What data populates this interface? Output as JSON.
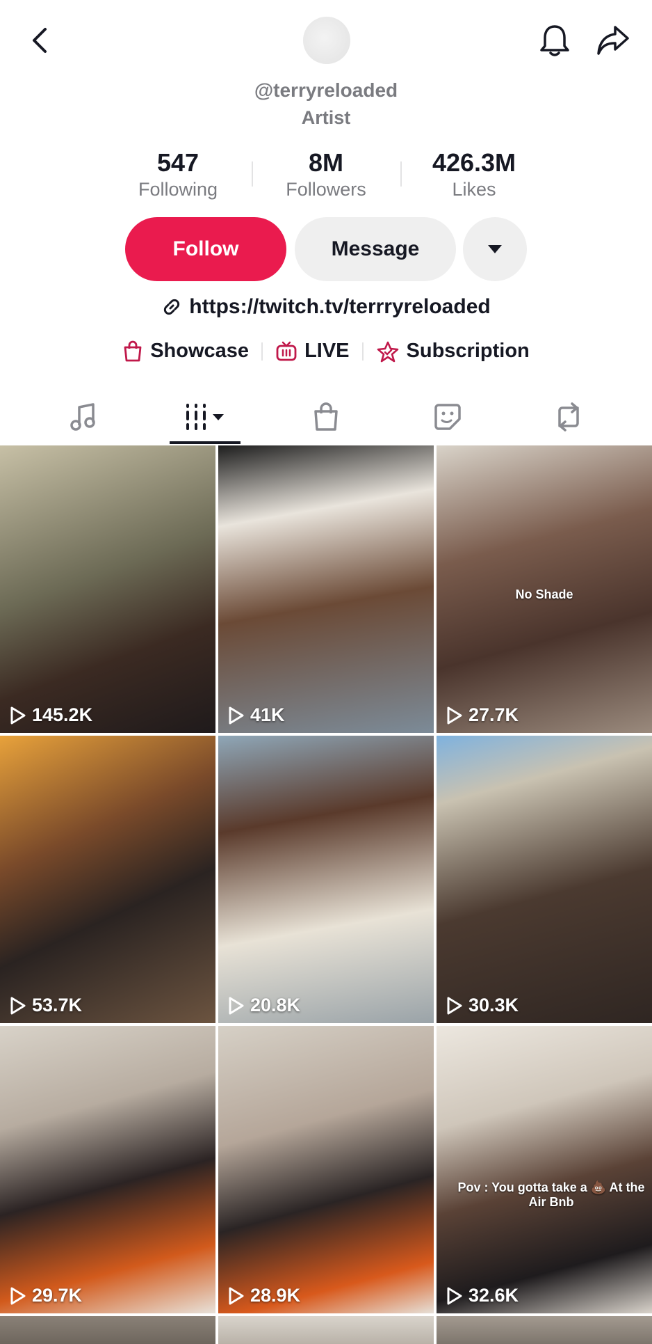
{
  "header": {
    "back_icon": "chevron-left-icon",
    "bell_icon": "bell-icon",
    "share_icon": "share-arrow-icon"
  },
  "profile": {
    "handle": "@terryreloaded",
    "bio": "Artist"
  },
  "stats": [
    {
      "value": "547",
      "label": "Following"
    },
    {
      "value": "8M",
      "label": "Followers"
    },
    {
      "value": "426.3M",
      "label": "Likes"
    }
  ],
  "actions": {
    "follow_label": "Follow",
    "message_label": "Message",
    "more_icon": "triangle-down-icon",
    "accent_color": "#ea1b4e"
  },
  "link": {
    "icon": "link-icon",
    "text": "https://twitch.tv/terrryreloaded"
  },
  "features": [
    {
      "icon": "shopping-bag-icon",
      "label": "Showcase"
    },
    {
      "icon": "live-tv-icon",
      "label": "LIVE"
    },
    {
      "icon": "star-badge-icon",
      "label": "Subscription"
    }
  ],
  "tabs": [
    {
      "icon": "music-note-icon",
      "active": false
    },
    {
      "icon": "videos-grid-icon",
      "active": true
    },
    {
      "icon": "shopping-bag-icon",
      "active": false
    },
    {
      "icon": "sticker-icon",
      "active": false
    },
    {
      "icon": "repost-icon",
      "active": false
    }
  ],
  "videos": [
    {
      "views": "145.2K",
      "caption": ""
    },
    {
      "views": "41K",
      "caption": ""
    },
    {
      "views": "27.7K",
      "caption": "No Shade"
    },
    {
      "views": "53.7K",
      "caption": ""
    },
    {
      "views": "20.8K",
      "caption": ""
    },
    {
      "views": "30.3K",
      "caption": ""
    },
    {
      "views": "29.7K",
      "caption": ""
    },
    {
      "views": "28.9K",
      "caption": ""
    },
    {
      "views": "32.6K",
      "caption": "Pov : You gotta take a 💩 At the Air Bnb"
    }
  ]
}
